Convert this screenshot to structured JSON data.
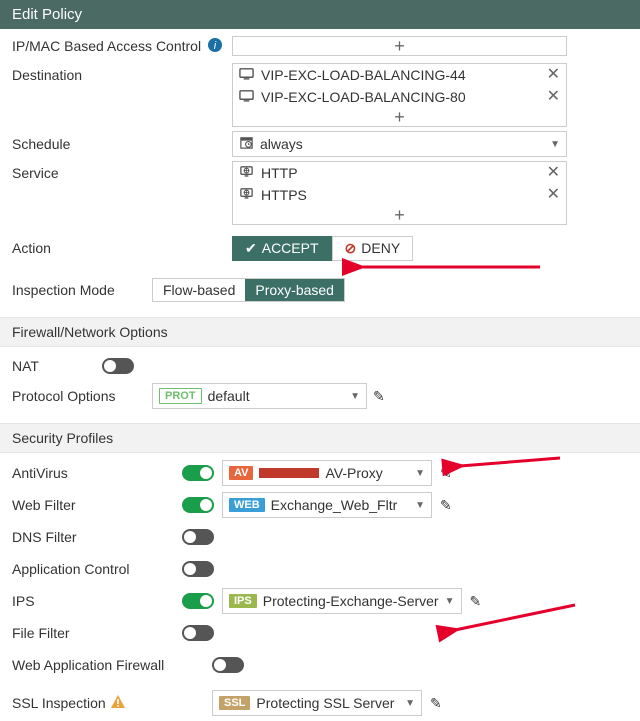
{
  "header": {
    "title": "Edit Policy"
  },
  "rows": {
    "ipmac_label": "IP/MAC Based Access Control",
    "destination_label": "Destination",
    "destination_items": [
      "VIP-EXC-LOAD-BALANCING-44",
      "VIP-EXC-LOAD-BALANCING-80"
    ],
    "schedule_label": "Schedule",
    "schedule_value": "always",
    "service_label": "Service",
    "service_items": [
      "HTTP",
      "HTTPS"
    ],
    "action_label": "Action",
    "action_accept": "ACCEPT",
    "action_deny": "DENY",
    "inspection_label": "Inspection Mode",
    "inspection_flow": "Flow-based",
    "inspection_proxy": "Proxy-based"
  },
  "groups": {
    "fw_net": "Firewall/Network Options",
    "nat_label": "NAT",
    "protocol_options_label": "Protocol Options",
    "protocol_options_tag": "PROT",
    "protocol_options_value": "default",
    "security_profiles": "Security Profiles"
  },
  "sec": {
    "av_label": "AntiVirus",
    "av_tag": "AV",
    "av_value": "AV-Proxy",
    "wf_label": "Web Filter",
    "wf_tag": "WEB",
    "wf_value": "Exchange_Web_Fltr",
    "dns_label": "DNS Filter",
    "app_label": "Application Control",
    "ips_label": "IPS",
    "ips_tag": "IPS",
    "ips_value": "Protecting-Exchange-Server",
    "ff_label": "File Filter",
    "waf_label": "Web Application Firewall",
    "ssl_label": "SSL Inspection",
    "ssl_tag": "SSL",
    "ssl_value": "Protecting SSL Server"
  }
}
